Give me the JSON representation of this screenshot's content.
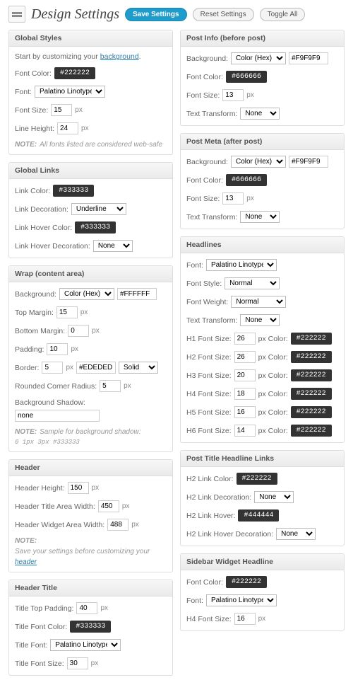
{
  "page": {
    "title": "Design Settings",
    "buttons": {
      "save": "Save Settings",
      "reset": "Reset Settings",
      "toggle": "Toggle All"
    }
  },
  "px": "px",
  "globalStyles": {
    "title": "Global Styles",
    "intro_before": "Start by customizing your ",
    "intro_link": "background",
    "intro_after": ".",
    "fontColorLabel": "Font Color:",
    "fontColor": "#222222",
    "fontLabel": "Font:",
    "font": "Palatino Linotype",
    "fontSizeLabel": "Font Size:",
    "fontSize": "15",
    "lineHeightLabel": "Line Height:",
    "lineHeight": "24",
    "noteLabel": "NOTE:",
    "note": " All fonts listed are considered web-safe"
  },
  "globalLinks": {
    "title": "Global Links",
    "linkColorLabel": "Link Color:",
    "linkColor": "#333333",
    "linkDecLabel": "Link Decoration:",
    "linkDec": "Underline",
    "linkHoverLabel": "Link Hover Color:",
    "linkHover": "#333333",
    "linkHoverDecLabel": "Link Hover Decoration:",
    "linkHoverDec": "None"
  },
  "wrap_panel": {
    "title": "Wrap (content area)",
    "bgLabel": "Background:",
    "bgType": "Color (Hex)",
    "bgVal": "#FFFFFF",
    "topMarginLabel": "Top Margin:",
    "topMargin": "15",
    "bottomMarginLabel": "Bottom Margin:",
    "bottomMargin": "0",
    "paddingLabel": "Padding:",
    "padding": "10",
    "borderLabel": "Border:",
    "borderSize": "5",
    "borderColor": "#EDEDED",
    "borderStyle": "Solid",
    "radiusLabel": "Rounded Corner Radius:",
    "radius": "5",
    "shadowLabel": "Background Shadow:",
    "shadow": "none",
    "noteLabel": "NOTE:",
    "note": " Sample for background shadow: ",
    "noteCode": "0 1px 3px #333333"
  },
  "header_panel": {
    "title": "Header",
    "heightLabel": "Header Height:",
    "height": "150",
    "titleWidthLabel": "Header Title Area Width:",
    "titleWidth": "450",
    "widgetWidthLabel": "Header Widget Area Width:",
    "widgetWidth": "488",
    "noteLabel": "NOTE:",
    "note": " Save your settings before customizing your ",
    "noteLink": "header"
  },
  "headerTitle": {
    "title": "Header Title",
    "topPadLabel": "Title Top Padding:",
    "topPad": "40",
    "colorLabel": "Title Font Color:",
    "color": "#333333",
    "fontLabel": "Title Font:",
    "font": "Palatino Linotype",
    "sizeLabel": "Title Font Size:",
    "size": "30"
  },
  "postInfo": {
    "title": "Post Info (before post)",
    "bgLabel": "Background:",
    "bgType": "Color (Hex)",
    "bgVal": "#F9F9F9",
    "colorLabel": "Font Color:",
    "color": "#666666",
    "sizeLabel": "Font Size:",
    "size": "13",
    "ttLabel": "Text Transform:",
    "tt": "None"
  },
  "postMeta": {
    "title": "Post Meta (after post)",
    "bgLabel": "Background:",
    "bgType": "Color (Hex)",
    "bgVal": "#F9F9F9",
    "colorLabel": "Font Color:",
    "color": "#666666",
    "sizeLabel": "Font Size:",
    "size": "13",
    "ttLabel": "Text Transform:",
    "tt": "None"
  },
  "headlines": {
    "title": "Headlines",
    "fontLabel": "Font:",
    "font": "Palatino Linotype",
    "styleLabel": "Font Style:",
    "style": "Normal",
    "weightLabel": "Font Weight:",
    "weight": "Normal",
    "ttLabel": "Text Transform:",
    "tt": "None",
    "colorLabel": "px Color:",
    "h1Label": "H1 Font Size:",
    "h1Size": "26",
    "h1Color": "#222222",
    "h2Label": "H2 Font Size:",
    "h2Size": "26",
    "h2Color": "#222222",
    "h3Label": "H3 Font Size:",
    "h3Size": "20",
    "h3Color": "#222222",
    "h4Label": "H4 Font Size:",
    "h4Size": "18",
    "h4Color": "#222222",
    "h5Label": "H5 Font Size:",
    "h5Size": "16",
    "h5Color": "#222222",
    "h6Label": "H6 Font Size:",
    "h6Size": "14",
    "h6Color": "#222222"
  },
  "postTitleLinks": {
    "title": "Post Title Headline Links",
    "colorLabel": "H2 Link Color:",
    "color": "#222222",
    "decLabel": "H2 Link Decoration:",
    "dec": "None",
    "hoverLabel": "H2 Link Hover:",
    "hover": "#444444",
    "hoverDecLabel": "H2 Link Hover Decoration:",
    "hoverDec": "None"
  },
  "sidebarWidget": {
    "title": "Sidebar Widget Headline",
    "colorLabel": "Font Color:",
    "color": "#222222",
    "fontLabel": "Font:",
    "font": "Palatino Linotype",
    "sizeLabel": "H4 Font Size:",
    "size": "16"
  }
}
